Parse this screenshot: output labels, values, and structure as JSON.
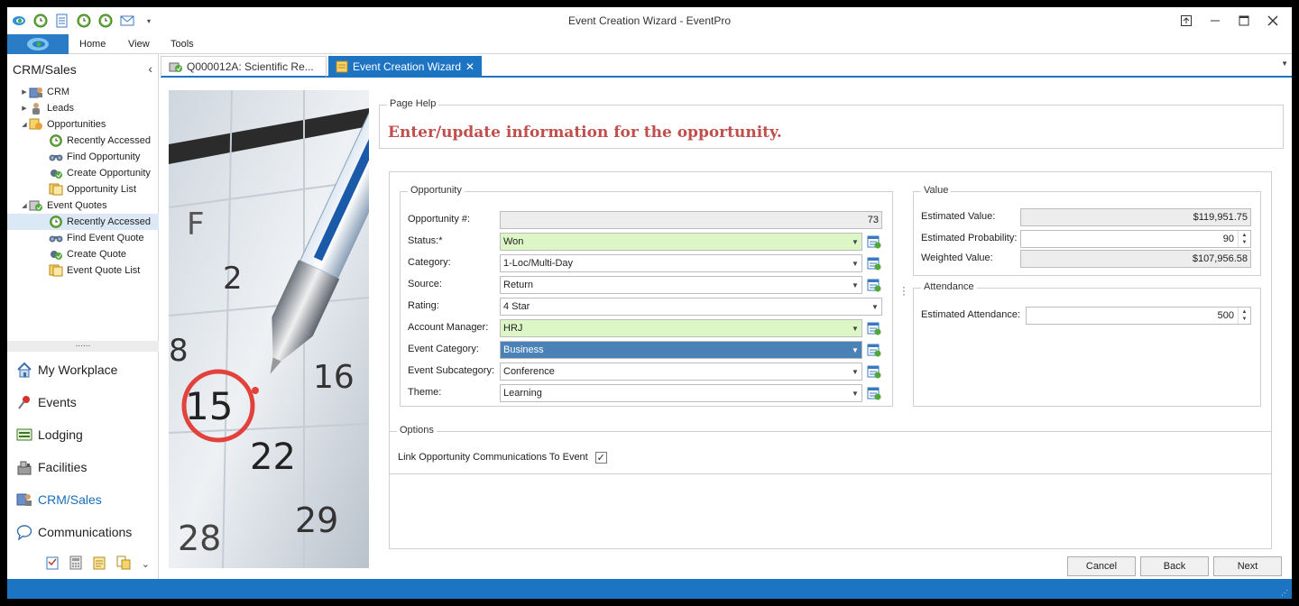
{
  "window": {
    "title": "Event Creation Wizard - EventPro"
  },
  "ribbon": {
    "tabs": [
      "Home",
      "View",
      "Tools"
    ]
  },
  "nav": {
    "title": "CRM/Sales",
    "tree": [
      {
        "label": "CRM",
        "level": 0,
        "arrow": "▶",
        "icon": "crm-icon"
      },
      {
        "label": "Leads",
        "level": 0,
        "arrow": "▶",
        "icon": "leads-icon"
      },
      {
        "label": "Opportunities",
        "level": 0,
        "arrow": "◢",
        "icon": "opportunities-icon"
      },
      {
        "label": "Recently Accessed",
        "level": 1,
        "arrow": "",
        "icon": "clock-icon"
      },
      {
        "label": "Find Opportunity",
        "level": 1,
        "arrow": "",
        "icon": "binoculars-icon"
      },
      {
        "label": "Create Opportunity",
        "level": 1,
        "arrow": "",
        "icon": "create-icon"
      },
      {
        "label": "Opportunity List",
        "level": 1,
        "arrow": "",
        "icon": "list-icon"
      },
      {
        "label": "Event Quotes",
        "level": 0,
        "arrow": "◢",
        "icon": "event-quotes-icon"
      },
      {
        "label": "Recently Accessed",
        "level": 1,
        "arrow": "",
        "icon": "clock-icon",
        "selected": true
      },
      {
        "label": "Find Event Quote",
        "level": 1,
        "arrow": "",
        "icon": "binoculars-icon"
      },
      {
        "label": "Create Quote",
        "level": 1,
        "arrow": "",
        "icon": "create-icon"
      },
      {
        "label": "Event Quote List",
        "level": 1,
        "arrow": "",
        "icon": "list-icon"
      }
    ],
    "splitter": "......",
    "modules": [
      {
        "label": "My Workplace",
        "icon": "house-icon"
      },
      {
        "label": "Events",
        "icon": "pin-icon"
      },
      {
        "label": "Lodging",
        "icon": "lodging-icon"
      },
      {
        "label": "Facilities",
        "icon": "facilities-icon"
      },
      {
        "label": "CRM/Sales",
        "icon": "crm-sales-icon",
        "active": true
      },
      {
        "label": "Communications",
        "icon": "speech-bubble-icon"
      }
    ]
  },
  "doctabs": {
    "inactive_label": "Q000012A: Scientific Re...",
    "active_label": "Event Creation Wizard",
    "close": "✕"
  },
  "page_help": {
    "legend": "Page Help",
    "text": "Enter/update information for the opportunity."
  },
  "opportunity": {
    "legend": "Opportunity",
    "fields": [
      {
        "label": "Opportunity #:",
        "value": "73",
        "kind": "readonly"
      },
      {
        "label": "Status:*",
        "value": "Won",
        "kind": "dropdown",
        "style": "green",
        "lookup": true
      },
      {
        "label": "Category:",
        "value": "1-Loc/Multi-Day",
        "kind": "dropdown",
        "lookup": true
      },
      {
        "label": "Source:",
        "value": "Return",
        "kind": "dropdown",
        "lookup": true
      },
      {
        "label": "Rating:",
        "value": "4 Star",
        "kind": "dropdown",
        "lookup": false
      },
      {
        "label": "Account Manager:",
        "value": "HRJ",
        "kind": "dropdown",
        "style": "green",
        "lookup": true
      },
      {
        "label": "Event Category:",
        "value": "Business",
        "kind": "dropdown",
        "style": "blue",
        "lookup": true
      },
      {
        "label": "Event Subcategory:",
        "value": "Conference",
        "kind": "dropdown",
        "lookup": true
      },
      {
        "label": "Theme:",
        "value": "Learning",
        "kind": "dropdown",
        "lookup": true
      }
    ]
  },
  "value": {
    "legend": "Value",
    "estimated_value_label": "Estimated Value:",
    "estimated_value": "$119,951.75",
    "estimated_probability_label": "Estimated Probability:",
    "estimated_probability": "90",
    "weighted_value_label": "Weighted Value:",
    "weighted_value": "$107,956.58"
  },
  "attendance": {
    "legend": "Attendance",
    "estimated_attendance_label": "Estimated Attendance:",
    "estimated_attendance": "500"
  },
  "options": {
    "legend": "Options",
    "link_label": "Link Opportunity Communications To Event",
    "link_checked": "✓"
  },
  "buttons": {
    "cancel": "Cancel",
    "back": "Back",
    "next": "Next"
  },
  "colors": {
    "accent": "#1c74c2",
    "help_text": "#c0504d",
    "required_green": "#dcf7c5",
    "selected_blue": "#4a82b8"
  }
}
